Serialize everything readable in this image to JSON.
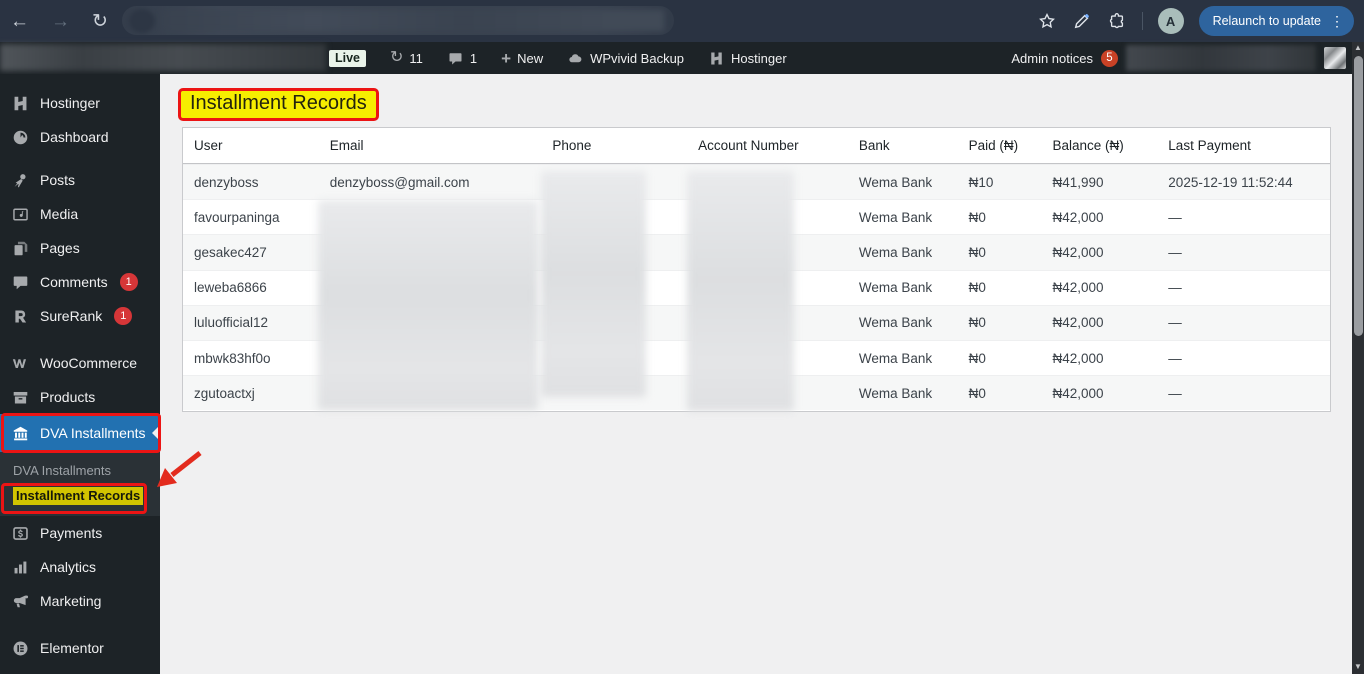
{
  "browser": {
    "relaunch_label": "Relaunch to update",
    "avatar_letter": "A"
  },
  "admin_bar": {
    "live_label": "Live",
    "updates_count": "11",
    "comments_count": "1",
    "new_label": "New",
    "wpvivid_label": "WPvivid Backup",
    "hostinger_label": "Hostinger",
    "admin_notices_label": "Admin notices",
    "admin_notices_count": "5"
  },
  "sidebar": {
    "items": [
      {
        "label": "Hostinger",
        "icon": "hostinger-icon"
      },
      {
        "label": "Dashboard",
        "icon": "dashboard-icon"
      },
      {
        "label": "Posts",
        "icon": "pin-icon",
        "sep": 1
      },
      {
        "label": "Media",
        "icon": "media-icon"
      },
      {
        "label": "Pages",
        "icon": "pages-icon"
      },
      {
        "label": "Comments",
        "icon": "comments-icon",
        "badge": "1"
      },
      {
        "label": "SureRank",
        "icon": "surerank-icon",
        "badge": "1"
      },
      {
        "label": "WooCommerce",
        "icon": "woocommerce-icon",
        "sep": 2
      },
      {
        "label": "Products",
        "icon": "products-icon"
      },
      {
        "label": "DVA Installments",
        "icon": "bank-icon",
        "active": true
      },
      {
        "label": "Payments",
        "icon": "payments-icon",
        "after_submenu": true
      },
      {
        "label": "Analytics",
        "icon": "analytics-icon"
      },
      {
        "label": "Marketing",
        "icon": "marketing-icon"
      },
      {
        "label": "Elementor",
        "icon": "elementor-icon",
        "sep": 2
      }
    ],
    "submenu": [
      {
        "label": "DVA Installments"
      },
      {
        "label": "Installment Records",
        "highlighted": true
      }
    ]
  },
  "main": {
    "title": "Installment Records",
    "table": {
      "headers": [
        "User",
        "Email",
        "Phone",
        "Account Number",
        "Bank",
        "Paid (₦)",
        "Balance (₦)",
        "Last Payment"
      ],
      "rows": [
        {
          "user": "denzyboss",
          "email": "denzyboss@gmail.com",
          "bank": "Wema Bank",
          "paid": "₦10",
          "balance": "₦41,990",
          "last_payment": "2025-12-19 11:52:44"
        },
        {
          "user": "favourpaninga",
          "bank": "Wema Bank",
          "paid": "₦0",
          "balance": "₦42,000",
          "last_payment": "—"
        },
        {
          "user": "gesakec427",
          "bank": "Wema Bank",
          "paid": "₦0",
          "balance": "₦42,000",
          "last_payment": "—"
        },
        {
          "user": "leweba6866",
          "bank": "Wema Bank",
          "paid": "₦0",
          "balance": "₦42,000",
          "last_payment": "—"
        },
        {
          "user": "luluofficial12",
          "bank": "Wema Bank",
          "paid": "₦0",
          "balance": "₦42,000",
          "last_payment": "—"
        },
        {
          "user": "mbwk83hf0o",
          "bank": "Wema Bank",
          "paid": "₦0",
          "balance": "₦42,000",
          "last_payment": "—"
        },
        {
          "user": "zgutoactxj",
          "bank": "Wema Bank",
          "paid": "₦0",
          "balance": "₦42,000",
          "last_payment": "—"
        }
      ]
    }
  },
  "colors": {
    "active_menu_blue": "#2271b1",
    "annotation_red": "#ec1414",
    "annotation_yellow": "#f6ee00",
    "badge_red": "#d63638",
    "notice_badge": "#c94226",
    "relaunch_blue": "#2e649e"
  }
}
